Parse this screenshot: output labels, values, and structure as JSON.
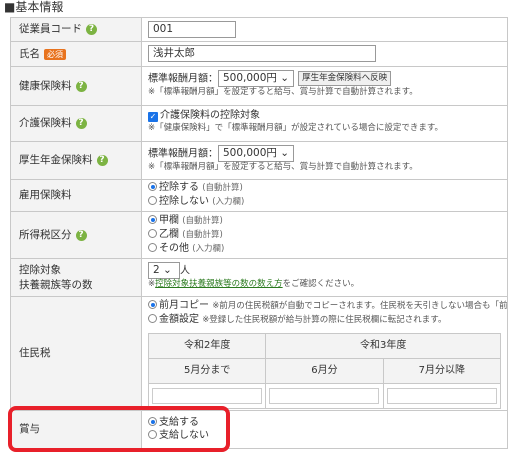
{
  "section_title": "■基本情報",
  "rows": {
    "code": {
      "label": "従業員コード",
      "value": "001"
    },
    "name": {
      "label": "氏名",
      "req": "必須",
      "value": "浅井太郎"
    },
    "health": {
      "label": "健康保険料",
      "sel_label": "標準報酬月額：",
      "sel_value": "500,000円",
      "btn": "厚生年金保険料へ反映",
      "note": "※「標準報酬月額」を設定すると給与、賞与計算で自動計算されます。"
    },
    "care": {
      "label": "介護保険料",
      "check": "介護保険料の控除対象",
      "note": "※「健康保険料」で「標準報酬月額」が設定されている場合に設定できます。"
    },
    "pension": {
      "label": "厚生年金保険料",
      "sel_label": "標準報酬月額：",
      "sel_value": "500,000円",
      "note": "※「標準報酬月額」を設定すると給与、賞与計算で自動計算されます。"
    },
    "employment": {
      "label": "雇用保険料",
      "opt1": "控除する",
      "opt1_note": "(自動計算)",
      "opt2": "控除しない",
      "opt2_note": "(入力欄)"
    },
    "tax": {
      "label": "所得税区分",
      "opt1": "甲欄",
      "opt1_note": "(自動計算)",
      "opt2": "乙欄",
      "opt2_note": "(自動計算)",
      "opt3": "その他",
      "opt3_note": "(入力欄)"
    },
    "dependents": {
      "label1": "控除対象",
      "label2": "扶養親族等の数",
      "value": "2",
      "unit": "人",
      "note_pre": "※",
      "note_link": "控除対象扶養親族等の数の数え方",
      "note_post": "をご確認ください。"
    },
    "resident": {
      "label": "住民税",
      "opt1": "前月コピー",
      "opt1_note": "※前月の住民税額が自動でコピーされます。住民税を天引きしない場合も「前月コ",
      "opt2": "金額設定",
      "opt2_note": "※登録した住民税額が給与計算の際に住民税欄に転記されます。",
      "th1": "令和2年度",
      "th2": "令和3年度",
      "c1": "5月分まで",
      "c2": "6月分",
      "c3": "7月分以降"
    },
    "bonus": {
      "label": "賞与",
      "opt1": "支給する",
      "opt2": "支給しない"
    }
  }
}
